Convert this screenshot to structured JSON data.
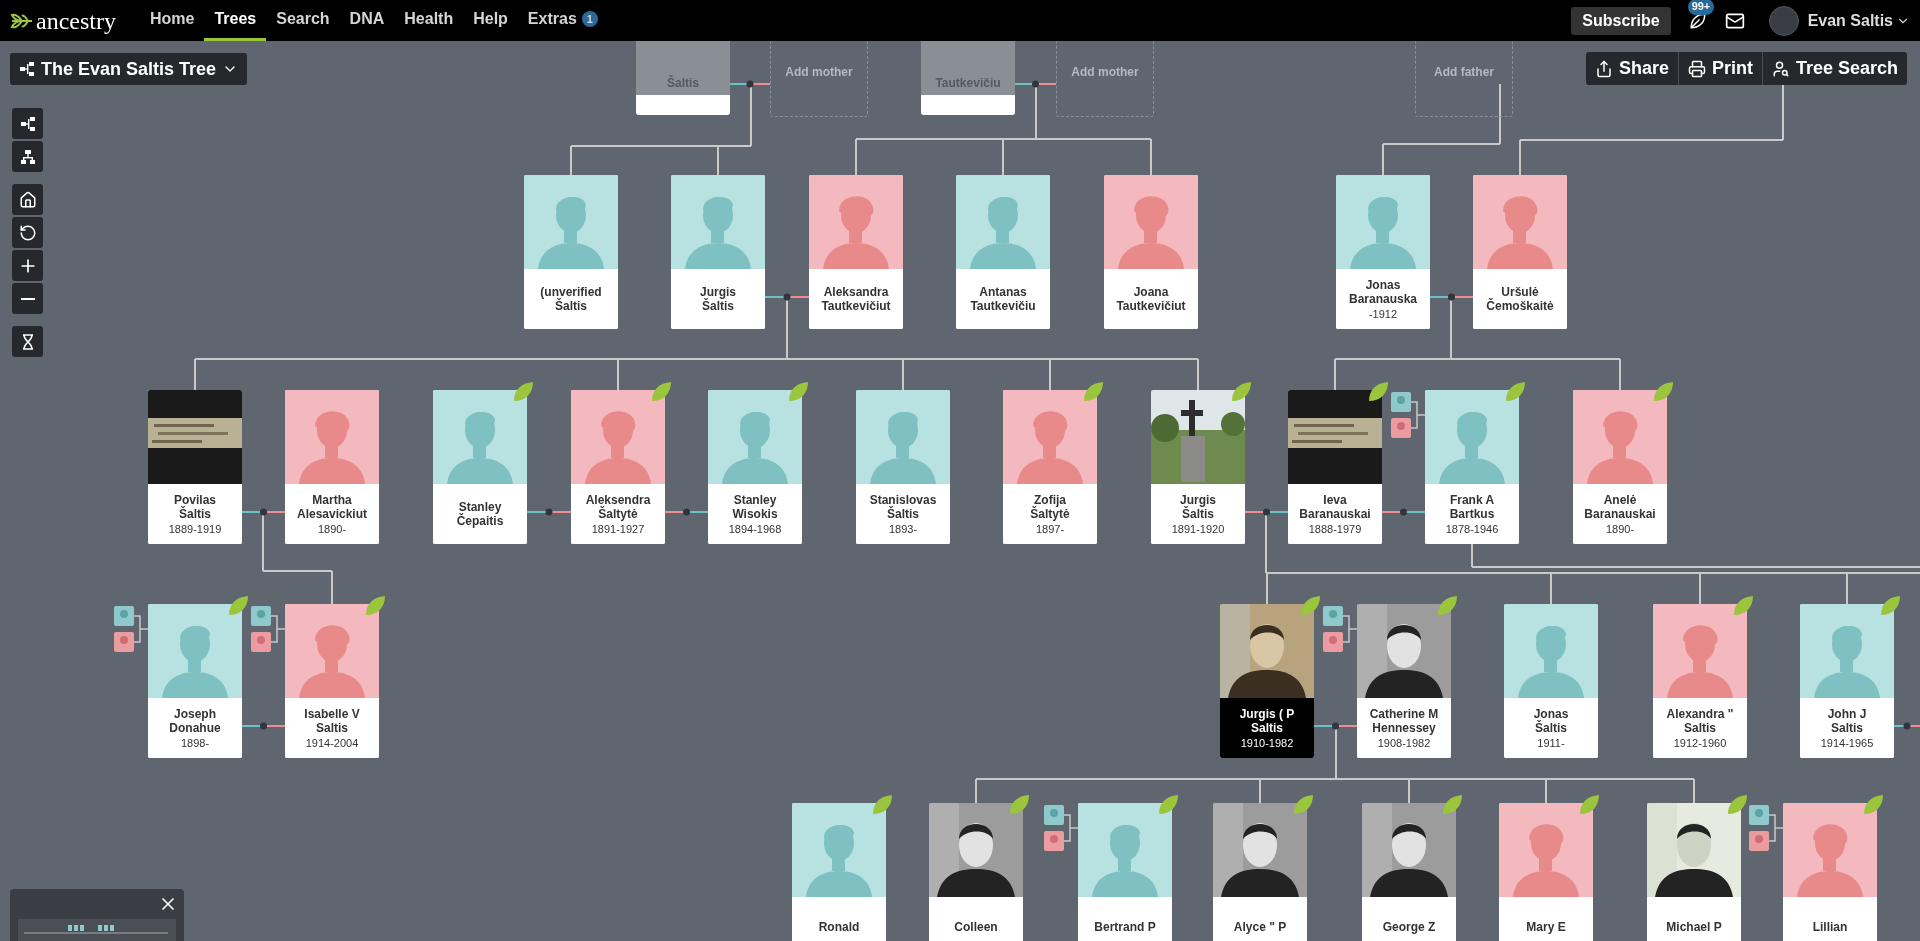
{
  "nav": {
    "logo": "ancestry",
    "items": [
      {
        "label": "Home",
        "selected": false
      },
      {
        "label": "Trees",
        "selected": true
      },
      {
        "label": "Search",
        "selected": false
      },
      {
        "label": "DNA",
        "selected": false
      },
      {
        "label": "Health",
        "selected": false
      },
      {
        "label": "Help",
        "selected": false
      },
      {
        "label": "Extras",
        "selected": false,
        "badge": "1"
      }
    ],
    "subscribe": "Subscribe",
    "notifications_badge": "99+",
    "user": "Evan Saltis"
  },
  "tree_title": "The Evan Saltis Tree",
  "actions": [
    {
      "kind": "share",
      "label": "Share"
    },
    {
      "kind": "print",
      "label": "Print"
    },
    {
      "kind": "search",
      "label": "Tree Search"
    }
  ],
  "ghost_row": [
    {
      "kind": "person",
      "name": "Šaltis"
    },
    {
      "kind": "add",
      "name": "Add mother"
    },
    {
      "kind": "person",
      "name": "Tautkevičiu"
    },
    {
      "kind": "add",
      "name": "Add mother"
    },
    {
      "kind": "add",
      "name": "Add father"
    }
  ],
  "generations": [
    {
      "cards": [
        {
          "kind": "male",
          "name_lines": [
            "(unverified",
            "Šaltis"
          ],
          "hint": false,
          "parents_icon": false,
          "selected": false
        },
        {
          "kind": "male",
          "name_lines": [
            "Jurgis",
            "Šaltis"
          ],
          "hint": false,
          "parents_icon": false,
          "selected": false
        },
        {
          "kind": "female",
          "name_lines": [
            "Aleksandra",
            "Tautkevičiut"
          ],
          "hint": false,
          "parents_icon": false,
          "selected": false
        },
        {
          "kind": "male",
          "name_lines": [
            "Antanas",
            "Tautkevičiu"
          ],
          "hint": false,
          "parents_icon": false,
          "selected": false
        },
        {
          "kind": "female",
          "name_lines": [
            "Joana",
            "Tautkevičiut"
          ],
          "hint": false,
          "parents_icon": false,
          "selected": false
        },
        {
          "kind": "male",
          "name_lines": [
            "Jonas",
            "Baranauska"
          ],
          "dates": "-1912",
          "hint": false,
          "parents_icon": false,
          "selected": false
        },
        {
          "kind": "female",
          "name_lines": [
            "Uršulė",
            "Čemoškaitė"
          ],
          "hint": false,
          "parents_icon": false,
          "selected": false
        }
      ]
    },
    {
      "cards": [
        {
          "name_lines": [
            "Povilas",
            "Šaltis"
          ],
          "dates": "1889-1919",
          "hint": false,
          "parents_icon": false,
          "selected": false
        },
        {
          "kind": "female",
          "name_lines": [
            "Martha",
            "Alesavickiut"
          ],
          "dates": "1890-",
          "hint": false,
          "parents_icon": false,
          "selected": false
        },
        {
          "kind": "male",
          "name_lines": [
            "Stanley",
            "Čepaitis"
          ],
          "hint": true,
          "parents_icon": false,
          "selected": false
        },
        {
          "kind": "female",
          "name_lines": [
            "Aleksendra",
            "Šaltytė"
          ],
          "dates": "1891-1927",
          "hint": true,
          "parents_icon": false,
          "selected": false
        },
        {
          "kind": "male",
          "name_lines": [
            "Stanley",
            "Wisokis"
          ],
          "dates": "1894-1968",
          "hint": true,
          "parents_icon": false,
          "selected": false
        },
        {
          "kind": "male",
          "name_lines": [
            "Stanislovas",
            "Šaltis"
          ],
          "dates": "1893-",
          "hint": false,
          "parents_icon": false,
          "selected": false
        },
        {
          "kind": "female",
          "name_lines": [
            "Zofija",
            "Šaltytė"
          ],
          "dates": "1897-",
          "hint": true,
          "parents_icon": false,
          "selected": false
        },
        {
          "name_lines": [
            "Jurgis",
            "Šaltis"
          ],
          "dates": "1891-1920",
          "hint": true,
          "parents_icon": false,
          "selected": false
        },
        {
          "name_lines": [
            "Ieva",
            "Baranauskai"
          ],
          "dates": "1888-1979",
          "hint": true,
          "parents_icon": false,
          "selected": false
        },
        {
          "kind": "male",
          "name_lines": [
            "Frank A",
            "Bartkus"
          ],
          "dates": "1878-1946",
          "hint": true,
          "parents_icon": true,
          "selected": false
        },
        {
          "kind": "female",
          "name_lines": [
            "Anelė",
            "Baranauskai"
          ],
          "dates": "1890-",
          "hint": true,
          "parents_icon": false,
          "selected": false
        }
      ]
    },
    {
      "cards": [
        {
          "kind": "male",
          "name_lines": [
            "Joseph",
            "Donahue"
          ],
          "dates": "1898-",
          "hint": true,
          "parents_icon": true,
          "selected": false
        },
        {
          "kind": "female",
          "name_lines": [
            "Isabelle V",
            "Saltis"
          ],
          "dates": "1914-2004",
          "hint": true,
          "parents_icon": true,
          "selected": false
        },
        {
          "name_lines": [
            "Jurgis ( P",
            "Saltis"
          ],
          "dates": "1910-1982",
          "hint": true,
          "parents_icon": false,
          "selected": true
        },
        {
          "name_lines": [
            "Catherine M",
            "Hennessey"
          ],
          "dates": "1908-1982",
          "hint": true,
          "parents_icon": true,
          "selected": false
        },
        {
          "kind": "male",
          "name_lines": [
            "Jonas",
            "Šaltis"
          ],
          "dates": "1911-",
          "hint": false,
          "parents_icon": false,
          "selected": false
        },
        {
          "kind": "female",
          "name_lines": [
            "Alexandra \"",
            "Saltis"
          ],
          "dates": "1912-1960",
          "hint": true,
          "parents_icon": false,
          "selected": false
        },
        {
          "kind": "male",
          "name_lines": [
            "John J",
            "Saltis"
          ],
          "dates": "1914-1965",
          "hint": true,
          "parents_icon": false,
          "selected": false
        }
      ]
    },
    {
      "cards": [
        {
          "kind": "male",
          "name_lines": [
            "Ronald"
          ],
          "hint": true,
          "parents_icon": false,
          "selected": false
        },
        {
          "name_lines": [
            "Colleen"
          ],
          "hint": true,
          "parents_icon": false,
          "selected": false
        },
        {
          "kind": "male",
          "name_lines": [
            "Bertrand P"
          ],
          "hint": true,
          "parents_icon": true,
          "selected": false
        },
        {
          "name_lines": [
            "Alyce \" P"
          ],
          "hint": true,
          "parents_icon": false,
          "selected": false
        },
        {
          "name_lines": [
            "George Z"
          ],
          "hint": true,
          "parents_icon": false,
          "selected": false
        },
        {
          "kind": "female",
          "name_lines": [
            "Mary E"
          ],
          "hint": true,
          "parents_icon": false,
          "selected": false
        },
        {
          "name_lines": [
            "Michael P"
          ],
          "hint": true,
          "parents_icon": false,
          "selected": false
        },
        {
          "kind": "female",
          "name_lines": [
            "Lillian"
          ],
          "hint": true,
          "parents_icon": true,
          "selected": false
        }
      ]
    }
  ]
}
